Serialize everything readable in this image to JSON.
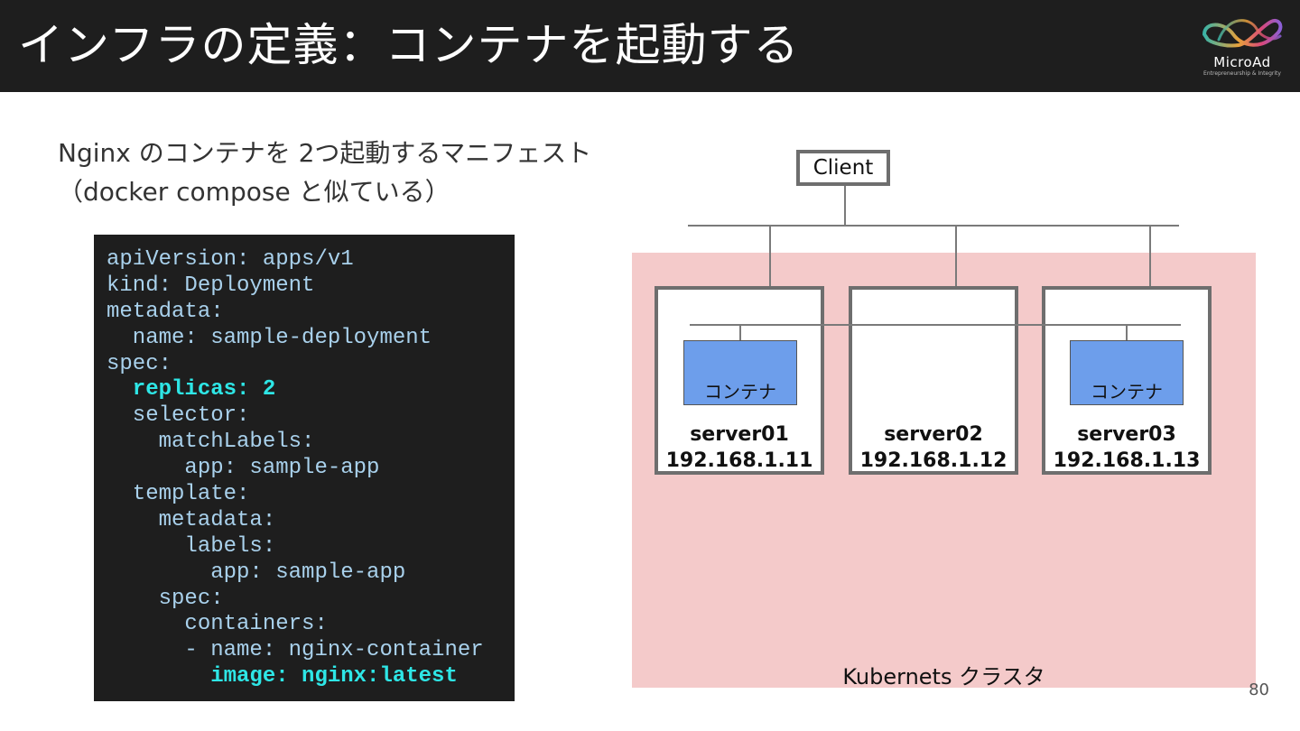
{
  "header": {
    "title": "インフラの定義：コンテナを起動する",
    "logo_text": "MicroAd",
    "logo_sub": "Entrepreneurship & Integrity"
  },
  "intro": {
    "line1": "Nginx のコンテナを 2つ起動するマニフェスト",
    "line2": "（docker compose と似ている）"
  },
  "code": {
    "lines": [
      {
        "text": "apiVersion: apps/v1",
        "highlight": false
      },
      {
        "text": "kind: Deployment",
        "highlight": false
      },
      {
        "text": "metadata:",
        "highlight": false
      },
      {
        "text": "  name: sample-deployment",
        "highlight": false
      },
      {
        "text": "spec:",
        "highlight": false
      },
      {
        "text": "  replicas: 2",
        "highlight": true
      },
      {
        "text": "  selector:",
        "highlight": false
      },
      {
        "text": "    matchLabels:",
        "highlight": false
      },
      {
        "text": "      app: sample-app",
        "highlight": false
      },
      {
        "text": "  template:",
        "highlight": false
      },
      {
        "text": "    metadata:",
        "highlight": false
      },
      {
        "text": "      labels:",
        "highlight": false
      },
      {
        "text": "        app: sample-app",
        "highlight": false
      },
      {
        "text": "    spec:",
        "highlight": false
      },
      {
        "text": "      containers:",
        "highlight": false
      },
      {
        "text": "      - name: nginx-container",
        "highlight": false
      },
      {
        "text": "        image: nginx:latest",
        "highlight": true
      }
    ]
  },
  "diagram": {
    "client_label": "Client",
    "cluster_label": "Kubernets クラスタ",
    "servers": [
      {
        "name": "server01",
        "ip": "192.168.1.11",
        "container": "コンテナ"
      },
      {
        "name": "server02",
        "ip": "192.168.1.12",
        "container": null
      },
      {
        "name": "server03",
        "ip": "192.168.1.13",
        "container": "コンテナ"
      }
    ]
  },
  "colors": {
    "header_bg": "#1e1e1e",
    "cluster_bg": "#f4caca",
    "container_fill": "#6d9eeb",
    "code_text": "#a9d1ec",
    "code_highlight": "#2ee6e6"
  },
  "page_number": "80"
}
